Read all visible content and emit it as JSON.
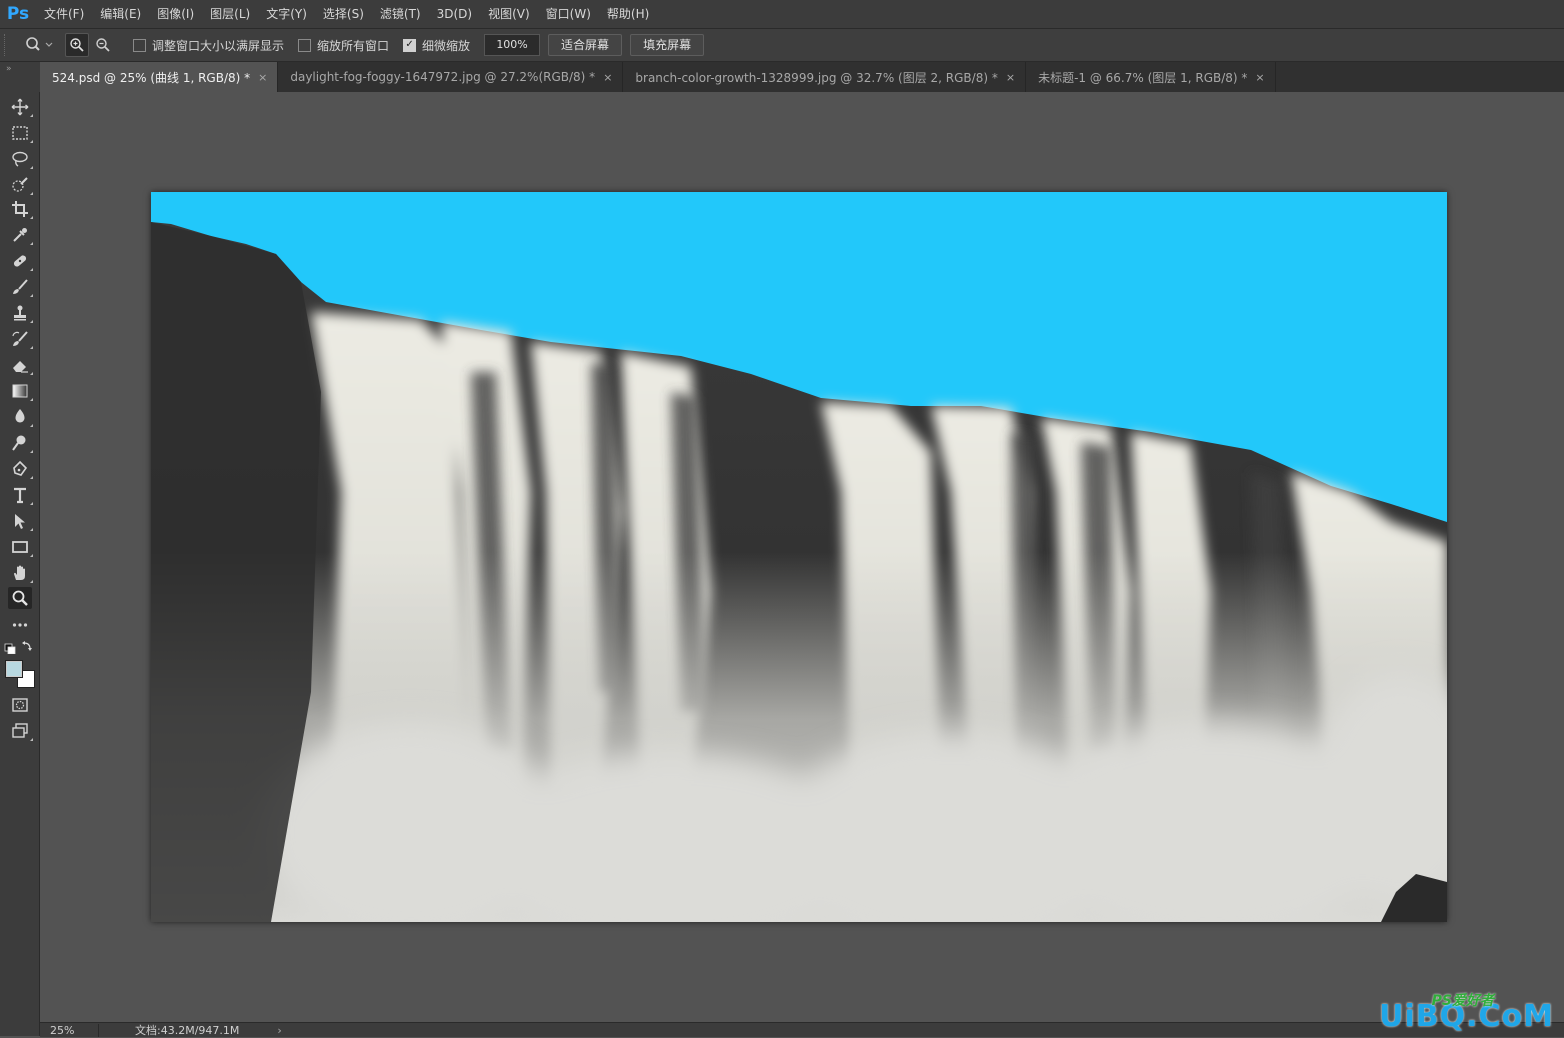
{
  "app": {
    "logo": "Ps",
    "menu": [
      "文件(F)",
      "编辑(E)",
      "图像(I)",
      "图层(L)",
      "文字(Y)",
      "选择(S)",
      "滤镜(T)",
      "3D(D)",
      "视图(V)",
      "窗口(W)",
      "帮助(H)"
    ]
  },
  "options": {
    "tool_icon": "zoom-icon",
    "resize_windows_label": "调整窗口大小以满屏显示",
    "resize_windows_checked": false,
    "zoom_all_label": "缩放所有窗口",
    "zoom_all_checked": false,
    "scrubby_zoom_label": "细微缩放",
    "scrubby_zoom_checked": true,
    "zoom_value": "100%",
    "fit_screen_label": "适合屏幕",
    "fill_screen_label": "填充屏幕"
  },
  "collapse_glyph": "»",
  "tabs": [
    {
      "label": "524.psd @ 25% (曲线 1, RGB/8) *",
      "active": true
    },
    {
      "label": "daylight-fog-foggy-1647972.jpg @ 27.2%(RGB/8) *",
      "active": false
    },
    {
      "label": "branch-color-growth-1328999.jpg @ 32.7% (图层 2, RGB/8) *",
      "active": false
    },
    {
      "label": "未标题-1 @ 66.7% (图层 1, RGB/8) *",
      "active": false
    }
  ],
  "tab_close_glyph": "×",
  "tools": [
    "move-icon",
    "marquee-icon",
    "lasso-icon",
    "quick-select-icon",
    "crop-icon",
    "eyedropper-icon",
    "healing-brush-icon",
    "brush-icon",
    "clone-stamp-icon",
    "history-brush-icon",
    "eraser-icon",
    "gradient-icon",
    "blur-icon",
    "dodge-icon",
    "pen-icon",
    "type-icon",
    "path-select-icon",
    "rectangle-icon",
    "hand-icon",
    "zoom-icon",
    "more-tools-icon"
  ],
  "active_tool": "zoom-icon",
  "colors": {
    "foreground": "#b8d8e0",
    "background": "#ffffff",
    "sky": "#22c8fa",
    "rock": "#3b3b3b",
    "water": "#e8e8e2"
  },
  "canvas": {
    "subject": "waterfall-photo"
  },
  "status": {
    "zoom": "25%",
    "doc_size": "文档:43.2M/947.1M",
    "arrow": "›"
  },
  "watermark": {
    "sub": "PS爱好者",
    "main": "UiBQ.CoM"
  }
}
